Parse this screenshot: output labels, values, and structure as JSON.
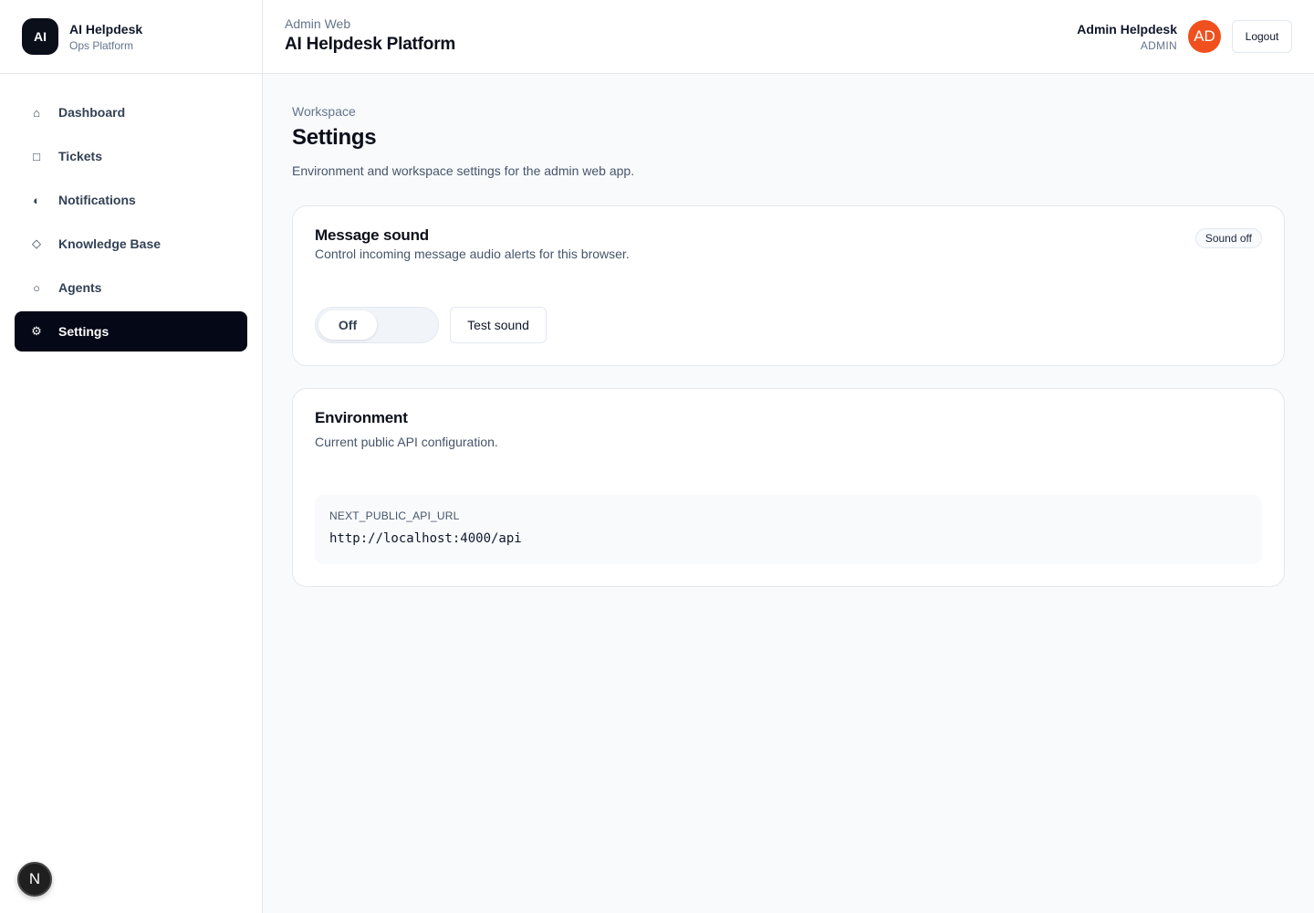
{
  "brand": {
    "logo": "AI",
    "name": "AI Helpdesk",
    "subtitle": "Ops Platform"
  },
  "sidebar": {
    "items": [
      {
        "label": "Dashboard",
        "icon": "home-icon",
        "glyph": "⌂",
        "active": false
      },
      {
        "label": "Tickets",
        "icon": "square-icon",
        "glyph": "□",
        "active": false
      },
      {
        "label": "Notifications",
        "icon": "half-circle-icon",
        "glyph": "◐",
        "active": false
      },
      {
        "label": "Knowledge Base",
        "icon": "diamond-icon",
        "glyph": "◇",
        "active": false
      },
      {
        "label": "Agents",
        "icon": "circle-icon",
        "glyph": "○",
        "active": false
      },
      {
        "label": "Settings",
        "icon": "gear-icon",
        "glyph": "⚙",
        "active": true
      }
    ]
  },
  "dev_badge": {
    "label": "N"
  },
  "header": {
    "eyebrow": "Admin Web",
    "title": "AI Helpdesk Platform",
    "user_name": "Admin Helpdesk",
    "user_role": "ADMIN",
    "avatar_initials": "AD",
    "logout_label": "Logout"
  },
  "page": {
    "eyebrow": "Workspace",
    "title": "Settings",
    "description": "Environment and workspace settings for the admin web app."
  },
  "sound_card": {
    "title": "Message sound",
    "description": "Control incoming message audio alerts for this browser.",
    "badge": "Sound off",
    "toggle_label": "Off",
    "test_label": "Test sound"
  },
  "env_card": {
    "title": "Environment",
    "description": "Current public API configuration.",
    "key": "NEXT_PUBLIC_API_URL",
    "value": "http://localhost:4000/api"
  },
  "colors": {
    "accent": "#050816",
    "avatar": "#f0501e"
  }
}
